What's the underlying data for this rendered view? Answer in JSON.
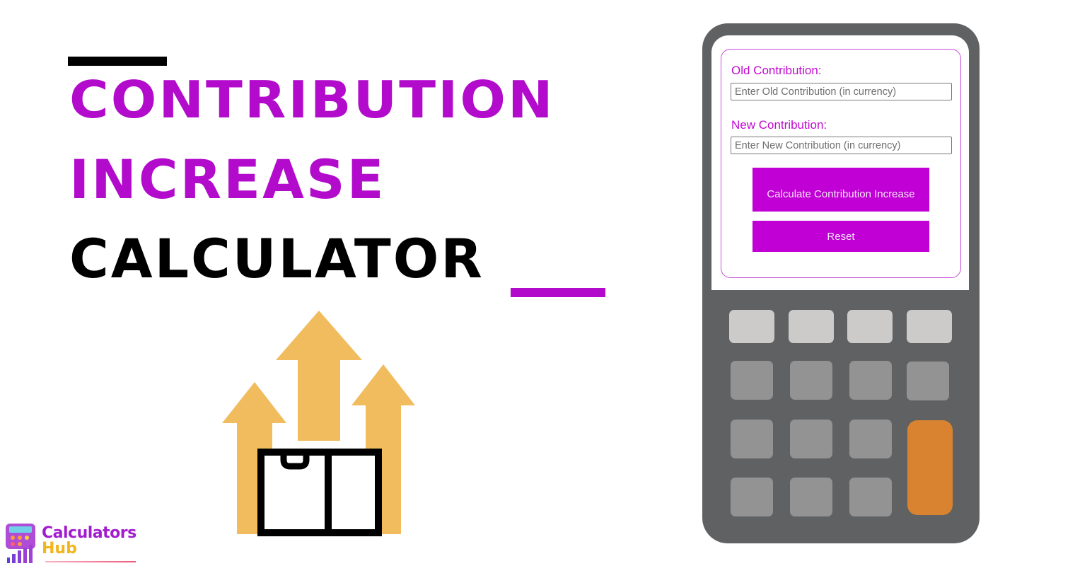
{
  "hero": {
    "title_line1": "Contribution",
    "title_line2": "Increase",
    "title_line3": "Calculator"
  },
  "brand": {
    "line1": "Calculators",
    "line2": "Hub"
  },
  "colors": {
    "accent": "#b20bcc",
    "button": "#c000d4",
    "arrow": "#f0bc5e",
    "calculator_body": "#606163",
    "key_light": "#cccbc9",
    "key_mid": "#939393",
    "key_orange": "#d98330"
  },
  "form": {
    "old_label": "Old Contribution:",
    "old_placeholder": "Enter Old Contribution (in currency)",
    "old_value": "",
    "new_label": "New Contribution:",
    "new_placeholder": "Enter New Contribution (in currency)",
    "new_value": "",
    "calculate_label": "Calculate Contribution Increase",
    "reset_label": "Reset"
  },
  "illustration": {
    "icon": "arrows-up-box-icon"
  }
}
